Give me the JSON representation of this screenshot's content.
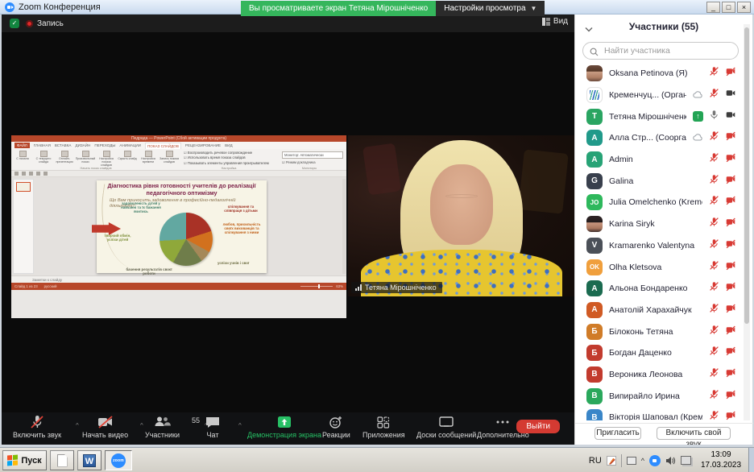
{
  "window": {
    "title": "Zoom Конференция"
  },
  "banner": {
    "viewing_text": "Вы просматриваете экран Тетяна Мірошніченко",
    "settings_label": "Настройки просмотра"
  },
  "meeting_topbar": {
    "record_label": "Запись",
    "view_label": "Вид"
  },
  "shared_screen": {
    "powerpoint": {
      "title": "Педрада — PowerPoint (Сбой активации продукта)",
      "ribbon_tabs": [
        "ФАЙЛ",
        "ГЛАВНАЯ",
        "ВСТАВКА",
        "ДИЗАЙН",
        "ПЕРЕХОДЫ",
        "АНИМАЦИИ",
        "ПОКАЗ СЛАЙДОВ",
        "РЕЦЕНЗИРОВАНИЕ",
        "ВИД"
      ],
      "active_tab": "ПОКАЗ СЛАЙДОВ",
      "ribbon_buttons": [
        "С начала",
        "С текущего слайда",
        "Онлайн-презентация",
        "Произвольный показ",
        "Настройка показа слайдов",
        "Скрыть слайд",
        "Настройка времени",
        "Запись показа слайдов"
      ],
      "checkboxes": [
        "Воспроизводить речевое сопровождение",
        "Использовать время показа слайдов",
        "Показывать элементы управления проигрывателем"
      ],
      "monitor_label": "Монитор: Автоматически",
      "presenter_checkbox": "Режим докладчика",
      "group_labels": [
        "Начать показ слайдов",
        "Настройка",
        "Мониторы"
      ],
      "notes_label": "Заметки к слайду",
      "status_left": "Слайд 1 из 23",
      "status_lang": "русский",
      "zoom_level": "63%",
      "slide": {
        "title": "Діагностика рівня готовності учителів до реалізації педагогічного оптимізму",
        "subtitle": "Що Вам приносить задоволення в професійно-педагогічній діяльності?"
      }
    }
  },
  "video_tile": {
    "name_tag": "Тетяна Мірошніченко"
  },
  "participants_panel": {
    "title": "Участники (55)",
    "search_placeholder": "Найти участника",
    "invite_label": "Пригласить",
    "unmute_label": "Включить свой звук",
    "list": [
      {
        "name": "Oksana Petinova (Я)",
        "avatar": "photo-a",
        "mic": "muted",
        "cam": "off"
      },
      {
        "name": "Кременчуц... (Организатор)",
        "avatar": "logo",
        "cloud": true,
        "mic": "muted",
        "cam": "on"
      },
      {
        "name": "Тетяна Мірошніченко",
        "avatar": "letter",
        "letter": "T",
        "color": "#2aa562",
        "share": true,
        "mic": "on",
        "cam": "on"
      },
      {
        "name": "Алла Стр... (Соорганизатор)",
        "avatar": "letter",
        "letter": "A",
        "color": "#219a8a",
        "cloud": true,
        "mic": "muted",
        "cam": "off"
      },
      {
        "name": "Admin",
        "avatar": "letter",
        "letter": "A",
        "color": "#27a376",
        "mic": "muted",
        "cam": "off"
      },
      {
        "name": "Galina",
        "avatar": "letter",
        "letter": "G",
        "color": "#39404d",
        "mic": "muted",
        "cam": "off"
      },
      {
        "name": "Julia Omelchenko (Kremenchuk)",
        "avatar": "letter",
        "letter": "JO",
        "color": "#2eb85c",
        "mic": "muted",
        "cam": "off"
      },
      {
        "name": "Karina Siryk",
        "avatar": "photo-b",
        "mic": "muted",
        "cam": "off"
      },
      {
        "name": "Kramarenko Valentyna",
        "avatar": "letter",
        "letter": "V",
        "color": "#4b5058",
        "mic": "muted",
        "cam": "off"
      },
      {
        "name": "Olha Kletsova",
        "avatar": "letter",
        "letter": "OK",
        "color": "#f09f3c",
        "mic": "muted",
        "cam": "off"
      },
      {
        "name": "Альона Бондаренко",
        "avatar": "letter",
        "letter": "А",
        "color": "#1b6b50",
        "mic": "muted",
        "cam": "off"
      },
      {
        "name": "Анатолій Харахайчук",
        "avatar": "letter",
        "letter": "А",
        "color": "#d05a24",
        "mic": "muted",
        "cam": "off"
      },
      {
        "name": "Білоконь Тетяна",
        "avatar": "letter",
        "letter": "Б",
        "color": "#d07c28",
        "mic": "muted",
        "cam": "off"
      },
      {
        "name": "Богдан Даценко",
        "avatar": "letter",
        "letter": "Б",
        "color": "#c23b2e",
        "mic": "muted",
        "cam": "off"
      },
      {
        "name": "Вероника Леонова",
        "avatar": "letter",
        "letter": "В",
        "color": "#c23b2e",
        "mic": "muted",
        "cam": "off"
      },
      {
        "name": "Випирайло Ирина",
        "avatar": "letter",
        "letter": "В",
        "color": "#2aa85c",
        "mic": "muted",
        "cam": "off"
      },
      {
        "name": "Вікторія Шаповал (Кременчук)",
        "avatar": "letter",
        "letter": "В",
        "color": "#3a86c8",
        "mic": "muted",
        "cam": "off"
      }
    ]
  },
  "toolbar": {
    "items": [
      {
        "label": "Включить звук"
      },
      {
        "label": "Начать видео"
      },
      {
        "label": "Участники"
      },
      {
        "label": "Чат"
      },
      {
        "label": "Демонстрация экрана"
      },
      {
        "label": "Реакции"
      },
      {
        "label": "Приложения"
      },
      {
        "label": "Доски сообщений"
      },
      {
        "label": "Дополнительно"
      }
    ],
    "participants_count": "55",
    "leave_label": "Выйти"
  },
  "taskbar": {
    "start_label": "Пуск",
    "language": "RU",
    "time": "13:09",
    "date": "17.03.2023"
  },
  "chart_data": {
    "type": "pie",
    "title": "Діагностика рівня готовності учителів до реалізації педагогічного оптимізму",
    "subtitle": "Що Вам приносить задоволення в професійно-педагогічній діяльності?",
    "labels": [
      {
        "text": "спілкування та співпраця з дітьми",
        "color": "#9e2f22"
      },
      {
        "text": "любов, прихильність своїх вихованців та спілкування з ними",
        "color": "#c06018"
      },
      {
        "text": "успіхи учнів і свої",
        "color": "#6f6f45"
      },
      {
        "text": "бачення результатів своєї роботи",
        "color": "#5f5f4a"
      },
      {
        "text": "творчий обмін, успіхи дітей",
        "color": "#7d8f3a"
      },
      {
        "text": "задоволеність дітей у навчанні та їх бажання вчитись",
        "color": "#3f7d68"
      }
    ],
    "values_percent": [
      20,
      13,
      7,
      18,
      16,
      26
    ],
    "colors": [
      "#a93226",
      "#d2711e",
      "#a58858",
      "#6f7d4a",
      "#8fa83a",
      "#62a8a1"
    ],
    "legend_position": "around"
  }
}
